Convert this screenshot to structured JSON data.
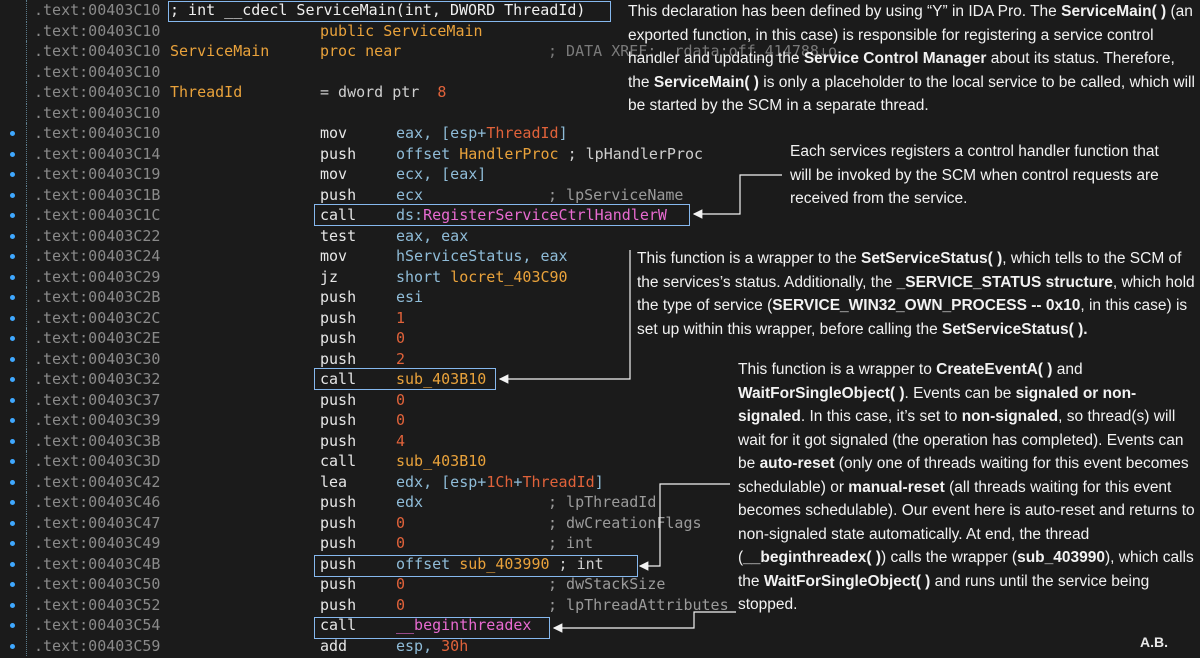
{
  "code_rows": [
    {
      "addr": ".text:00403C10",
      "label": "",
      "mn": "; int __cdecl ServiceMain(int, DWORD ThreadId)",
      "op": "",
      "cm": "",
      "dot": false
    },
    {
      "addr": ".text:00403C10",
      "label": "",
      "mn": "public ServiceMain",
      "op": "",
      "cm": "",
      "dot": false
    },
    {
      "addr": ".text:00403C10",
      "label": "ServiceMain",
      "mn": "proc near",
      "op": "",
      "cm": "; DATA XREF: .rdata:off_414788↓o",
      "dot": false
    },
    {
      "addr": ".text:00403C10",
      "label": "",
      "mn": "",
      "op": "",
      "cm": "",
      "dot": false
    },
    {
      "addr": ".text:00403C10",
      "label": "ThreadId",
      "mn": "= dword ptr  8",
      "op": "",
      "cm": "",
      "dot": false
    },
    {
      "addr": ".text:00403C10",
      "label": "",
      "mn": "",
      "op": "",
      "cm": "",
      "dot": false
    },
    {
      "addr": ".text:00403C10",
      "label": "",
      "mn": "mov",
      "op": "eax, [esp+ThreadId]",
      "cm": "",
      "dot": true
    },
    {
      "addr": ".text:00403C14",
      "label": "",
      "mn": "push",
      "op": "offset HandlerProc ; lpHandlerProc",
      "cm": "",
      "dot": true
    },
    {
      "addr": ".text:00403C19",
      "label": "",
      "mn": "mov",
      "op": "ecx, [eax]",
      "cm": "",
      "dot": true
    },
    {
      "addr": ".text:00403C1B",
      "label": "",
      "mn": "push",
      "op": "ecx",
      "cm": "; lpServiceName",
      "dot": true
    },
    {
      "addr": ".text:00403C1C",
      "label": "",
      "mn": "call",
      "op": "ds:RegisterServiceCtrlHandlerW",
      "cm": "",
      "dot": true
    },
    {
      "addr": ".text:00403C22",
      "label": "",
      "mn": "test",
      "op": "eax, eax",
      "cm": "",
      "dot": true
    },
    {
      "addr": ".text:00403C24",
      "label": "",
      "mn": "mov",
      "op": "hServiceStatus, eax",
      "cm": "",
      "dot": true
    },
    {
      "addr": ".text:00403C29",
      "label": "",
      "mn": "jz",
      "op": "short locret_403C90",
      "cm": "",
      "dot": true
    },
    {
      "addr": ".text:00403C2B",
      "label": "",
      "mn": "push",
      "op": "esi",
      "cm": "",
      "dot": true
    },
    {
      "addr": ".text:00403C2C",
      "label": "",
      "mn": "push",
      "op": "1",
      "cm": "",
      "dot": true
    },
    {
      "addr": ".text:00403C2E",
      "label": "",
      "mn": "push",
      "op": "0",
      "cm": "",
      "dot": true
    },
    {
      "addr": ".text:00403C30",
      "label": "",
      "mn": "push",
      "op": "2",
      "cm": "",
      "dot": true
    },
    {
      "addr": ".text:00403C32",
      "label": "",
      "mn": "call",
      "op": "sub_403B10",
      "cm": "",
      "dot": true
    },
    {
      "addr": ".text:00403C37",
      "label": "",
      "mn": "push",
      "op": "0",
      "cm": "",
      "dot": true
    },
    {
      "addr": ".text:00403C39",
      "label": "",
      "mn": "push",
      "op": "0",
      "cm": "",
      "dot": true
    },
    {
      "addr": ".text:00403C3B",
      "label": "",
      "mn": "push",
      "op": "4",
      "cm": "",
      "dot": true
    },
    {
      "addr": ".text:00403C3D",
      "label": "",
      "mn": "call",
      "op": "sub_403B10",
      "cm": "",
      "dot": true
    },
    {
      "addr": ".text:00403C42",
      "label": "",
      "mn": "lea",
      "op": "edx, [esp+1Ch+ThreadId]",
      "cm": "",
      "dot": true
    },
    {
      "addr": ".text:00403C46",
      "label": "",
      "mn": "push",
      "op": "edx",
      "cm": "; lpThreadId",
      "dot": true
    },
    {
      "addr": ".text:00403C47",
      "label": "",
      "mn": "push",
      "op": "0",
      "cm": "; dwCreationFlags",
      "dot": true
    },
    {
      "addr": ".text:00403C49",
      "label": "",
      "mn": "push",
      "op": "0",
      "cm": "; int",
      "dot": true
    },
    {
      "addr": ".text:00403C4B",
      "label": "",
      "mn": "push",
      "op": "offset sub_403990 ; int",
      "cm": "",
      "dot": true
    },
    {
      "addr": ".text:00403C50",
      "label": "",
      "mn": "push",
      "op": "0",
      "cm": "; dwStackSize",
      "dot": true
    },
    {
      "addr": ".text:00403C52",
      "label": "",
      "mn": "push",
      "op": "0",
      "cm": "; lpThreadAttributes",
      "dot": true
    },
    {
      "addr": ".text:00403C54",
      "label": "",
      "mn": "call",
      "op": "__beginthreadex",
      "cm": "",
      "dot": true
    },
    {
      "addr": ".text:00403C59",
      "label": "",
      "mn": "add",
      "op": "esp, 30h",
      "cm": "",
      "dot": true
    }
  ],
  "notes": {
    "n1": "This declaration has been defined by using \"Y\" in IDA Pro. The ServiceMain( ) (an exported function, in this case) is responsible for registering a service control handler and updating the Service Control Manager about its status. Therefore, the ServiceMain( ) is only a placeholder to the local service to be called, which will be started by the SCM in a separate thread.",
    "n2": "Each services registers a control handler function that will be invoked by the SCM when control requests are received from the service.",
    "n3": "This function is a wrapper to the SetServiceStatus( ), which tells to the SCM of the services's status. Additionally, the _SERVICE_STATUS structure, which hold the type of service (SERVICE_WIN32_OWN_PROCESS -- 0x10, in this case) is set up within this wrapper, before calling the SetServiceStatus( ).",
    "n4": "This function is a wrapper to CreateEventA( ) and WaitForSingleObject( ). Events can be signaled or non-signaled. In this case, it's set to non-signaled, so thread(s) will wait for it got signaled (the operation has completed). Events can be auto-reset (only one of threads waiting for this event becomes schedulable) or manual-reset (all threads waiting for this event becomes schedulable). Our event here is auto-reset and returns to non-signaled state automatically. At end, the thread (__beginthreadex( )) calls the wrapper (sub_403990), which calls the WaitForSingleObject( ) and runs until the service being stopped."
  },
  "signature": "A.B.",
  "colors": {
    "number": "#e0623a",
    "label": "#e9a23b",
    "api": "#e86bd1",
    "address": "#8a8a8a",
    "accent": "#86b8ee"
  }
}
